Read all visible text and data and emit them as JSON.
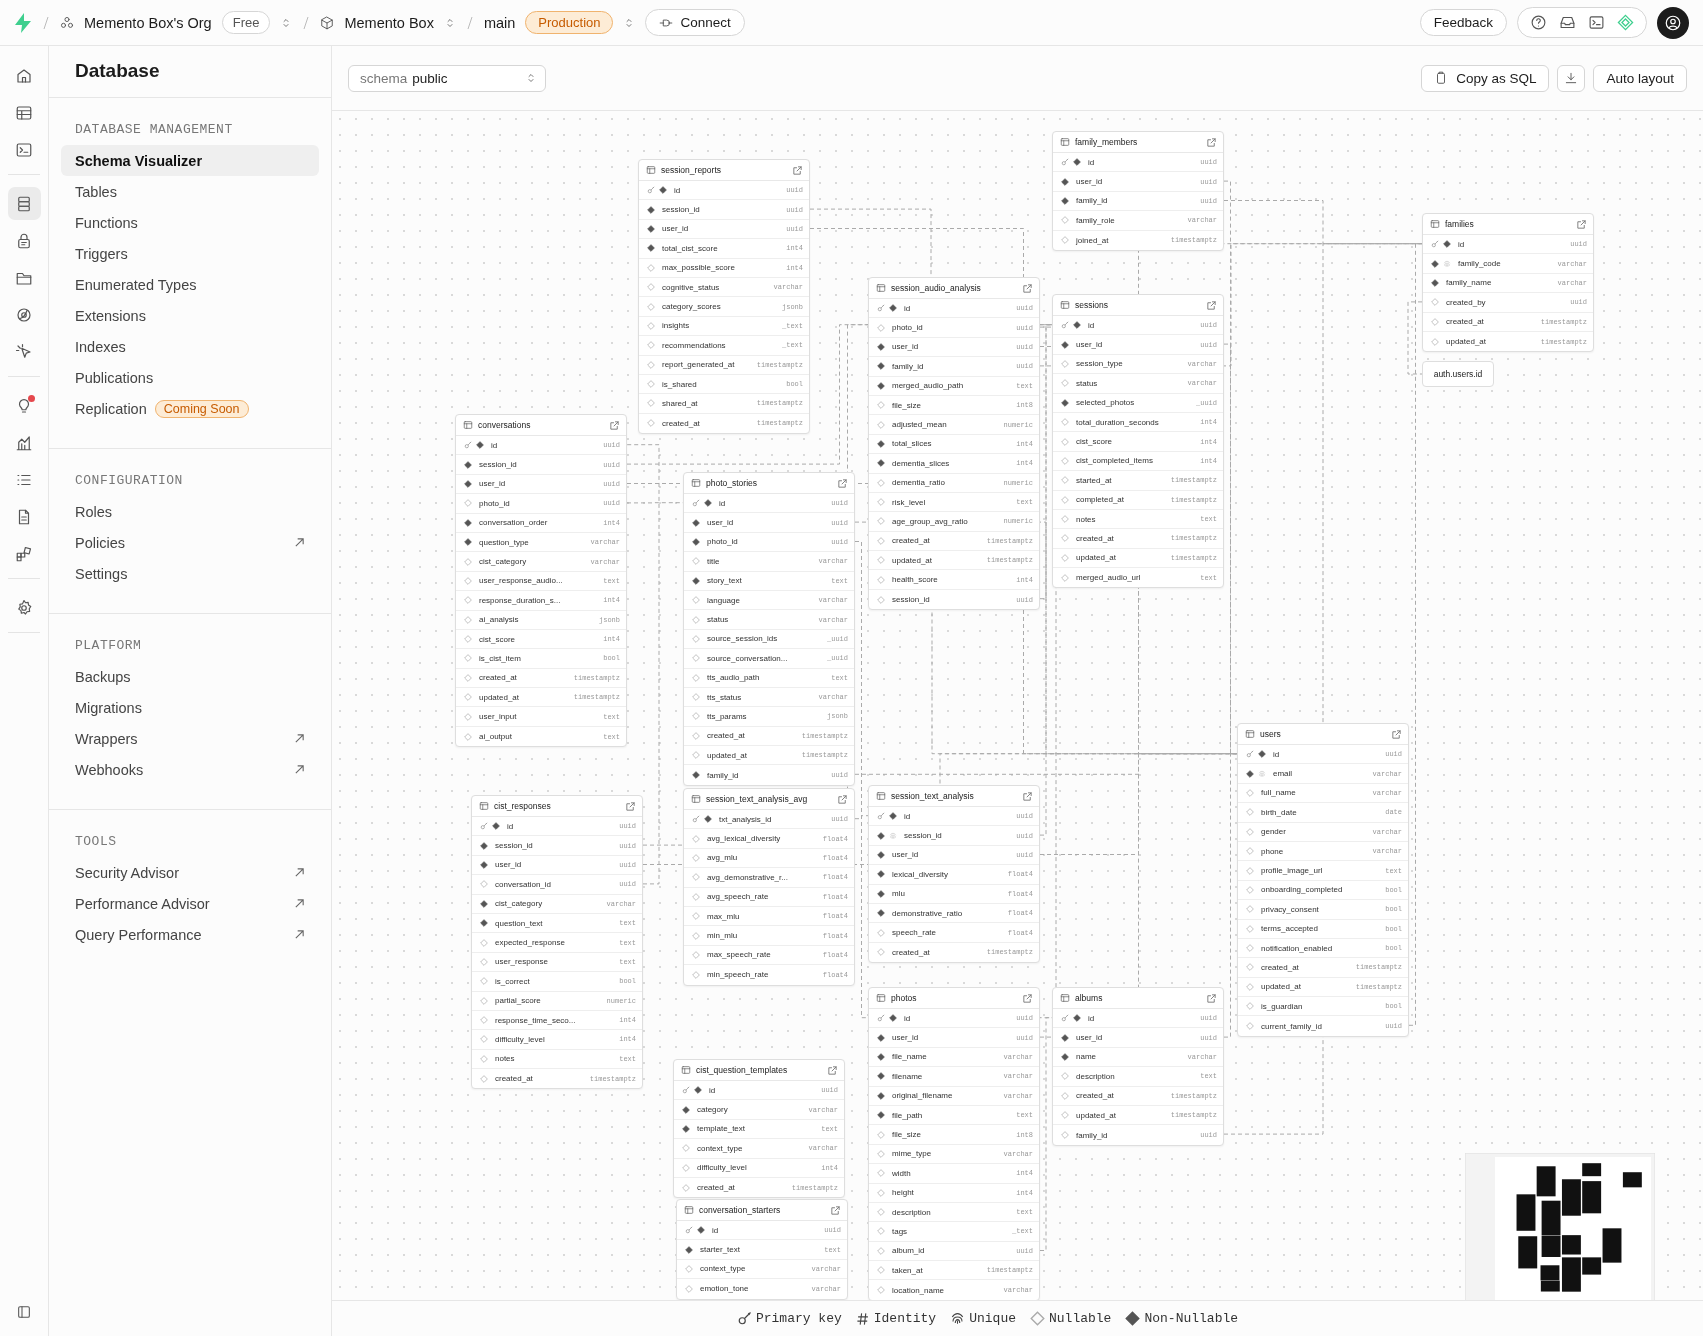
{
  "topbar": {
    "org": "Memento Box's Org",
    "plan": "Free",
    "project": "Memento Box",
    "branch": "main",
    "environment": "Production",
    "connect": "Connect",
    "feedback": "Feedback"
  },
  "rail_groups": [
    {
      "items": [
        {
          "kind": "home",
          "selected": false,
          "alert": false
        },
        {
          "kind": "table",
          "selected": false,
          "alert": false
        },
        {
          "kind": "terminal",
          "selected": false,
          "alert": false
        }
      ]
    },
    {
      "items": [
        {
          "kind": "database",
          "selected": true,
          "alert": false
        },
        {
          "kind": "lock",
          "selected": false,
          "alert": false
        },
        {
          "kind": "folder",
          "selected": false,
          "alert": false
        },
        {
          "kind": "realtime",
          "selected": false,
          "alert": false
        },
        {
          "kind": "cursor",
          "selected": false,
          "alert": false
        }
      ]
    },
    {
      "items": [
        {
          "kind": "bulb",
          "selected": false,
          "alert": true
        },
        {
          "kind": "chart",
          "selected": false,
          "alert": false
        },
        {
          "kind": "list",
          "selected": false,
          "alert": false
        },
        {
          "kind": "doc",
          "selected": false,
          "alert": false
        },
        {
          "kind": "blocks",
          "selected": false,
          "alert": false
        }
      ]
    },
    {
      "items": [
        {
          "kind": "gear",
          "selected": false,
          "alert": false
        }
      ]
    }
  ],
  "sidebar": {
    "title": "Database",
    "sections": [
      {
        "heading": "DATABASE MANAGEMENT",
        "items": [
          {
            "label": "Schema Visualizer",
            "selected": true,
            "external": false
          },
          {
            "label": "Tables",
            "selected": false,
            "external": false
          },
          {
            "label": "Functions",
            "selected": false,
            "external": false
          },
          {
            "label": "Triggers",
            "selected": false,
            "external": false
          },
          {
            "label": "Enumerated Types",
            "selected": false,
            "external": false
          },
          {
            "label": "Extensions",
            "selected": false,
            "external": false
          },
          {
            "label": "Indexes",
            "selected": false,
            "external": false
          },
          {
            "label": "Publications",
            "selected": false,
            "external": false
          },
          {
            "label": "Replication",
            "selected": false,
            "external": false,
            "badge": "Coming Soon"
          }
        ]
      },
      {
        "heading": "CONFIGURATION",
        "items": [
          {
            "label": "Roles",
            "selected": false,
            "external": false
          },
          {
            "label": "Policies",
            "selected": false,
            "external": true
          },
          {
            "label": "Settings",
            "selected": false,
            "external": false
          }
        ]
      },
      {
        "heading": "PLATFORM",
        "items": [
          {
            "label": "Backups",
            "selected": false,
            "external": false
          },
          {
            "label": "Migrations",
            "selected": false,
            "external": false
          },
          {
            "label": "Wrappers",
            "selected": false,
            "external": true
          },
          {
            "label": "Webhooks",
            "selected": false,
            "external": true
          }
        ]
      },
      {
        "heading": "TOOLS",
        "items": [
          {
            "label": "Security Advisor",
            "selected": false,
            "external": true
          },
          {
            "label": "Performance Advisor",
            "selected": false,
            "external": true
          },
          {
            "label": "Query Performance",
            "selected": false,
            "external": true
          }
        ]
      }
    ]
  },
  "toolbar": {
    "schema_label": "schema",
    "schema": "public",
    "buttons": [
      {
        "kind": "copy",
        "label": "Copy as SQL"
      },
      {
        "kind": "download"
      },
      {
        "kind": "plain",
        "label": "Auto layout"
      }
    ]
  },
  "tables": [
    {
      "name": "session_reports",
      "columns": [
        {
          "name": "id",
          "type": "uuid",
          "pk": true,
          "unique": false,
          "nullable": false
        },
        {
          "name": "session_id",
          "type": "uuid",
          "pk": false,
          "unique": false,
          "nullable": false
        },
        {
          "name": "user_id",
          "type": "uuid",
          "pk": false,
          "unique": false,
          "nullable": false
        },
        {
          "name": "total_cist_score",
          "type": "int4",
          "pk": false,
          "unique": false,
          "nullable": false
        },
        {
          "name": "max_possible_score",
          "type": "int4",
          "pk": false,
          "unique": false,
          "nullable": true
        },
        {
          "name": "cognitive_status",
          "type": "varchar",
          "pk": false,
          "unique": false,
          "nullable": true
        },
        {
          "name": "category_scores",
          "type": "jsonb",
          "pk": false,
          "unique": false,
          "nullable": true
        },
        {
          "name": "insights",
          "type": "_text",
          "pk": false,
          "unique": false,
          "nullable": true
        },
        {
          "name": "recommendations",
          "type": "_text",
          "pk": false,
          "unique": false,
          "nullable": true
        },
        {
          "name": "report_generated_at",
          "type": "timestamptz",
          "pk": false,
          "unique": false,
          "nullable": true
        },
        {
          "name": "is_shared",
          "type": "bool",
          "pk": false,
          "unique": false,
          "nullable": true
        },
        {
          "name": "shared_at",
          "type": "timestamptz",
          "pk": false,
          "unique": false,
          "nullable": true
        },
        {
          "name": "created_at",
          "type": "timestamptz",
          "pk": false,
          "unique": false,
          "nullable": true
        }
      ]
    },
    {
      "name": "family_members",
      "columns": [
        {
          "name": "id",
          "type": "uuid",
          "pk": true,
          "unique": false,
          "nullable": false
        },
        {
          "name": "user_id",
          "type": "uuid",
          "pk": false,
          "unique": false,
          "nullable": false
        },
        {
          "name": "family_id",
          "type": "uuid",
          "pk": false,
          "unique": false,
          "nullable": false
        },
        {
          "name": "family_role",
          "type": "varchar",
          "pk": false,
          "unique": false,
          "nullable": true
        },
        {
          "name": "joined_at",
          "type": "timestamptz",
          "pk": false,
          "unique": false,
          "nullable": true
        }
      ]
    },
    {
      "name": "families",
      "columns": [
        {
          "name": "id",
          "type": "uuid",
          "pk": true,
          "unique": false,
          "nullable": false
        },
        {
          "name": "family_code",
          "type": "varchar",
          "pk": false,
          "unique": true,
          "nullable": false
        },
        {
          "name": "family_name",
          "type": "varchar",
          "pk": false,
          "unique": false,
          "nullable": false
        },
        {
          "name": "created_by",
          "type": "uuid",
          "pk": false,
          "unique": false,
          "nullable": true
        },
        {
          "name": "created_at",
          "type": "timestamptz",
          "pk": false,
          "unique": false,
          "nullable": true
        },
        {
          "name": "updated_at",
          "type": "timestamptz",
          "pk": false,
          "unique": false,
          "nullable": true
        }
      ]
    },
    {
      "name": "session_audio_analysis",
      "columns": [
        {
          "name": "id",
          "type": "uuid",
          "pk": true,
          "unique": false,
          "nullable": false
        },
        {
          "name": "photo_id",
          "type": "uuid",
          "pk": false,
          "unique": false,
          "nullable": true
        },
        {
          "name": "user_id",
          "type": "uuid",
          "pk": false,
          "unique": false,
          "nullable": false
        },
        {
          "name": "family_id",
          "type": "uuid",
          "pk": false,
          "unique": false,
          "nullable": false
        },
        {
          "name": "merged_audio_path",
          "type": "text",
          "pk": false,
          "unique": false,
          "nullable": false
        },
        {
          "name": "file_size",
          "type": "int8",
          "pk": false,
          "unique": false,
          "nullable": true
        },
        {
          "name": "adjusted_mean",
          "type": "numeric",
          "pk": false,
          "unique": false,
          "nullable": true
        },
        {
          "name": "total_slices",
          "type": "int4",
          "pk": false,
          "unique": false,
          "nullable": false
        },
        {
          "name": "dementia_slices",
          "type": "int4",
          "pk": false,
          "unique": false,
          "nullable": false
        },
        {
          "name": "dementia_ratio",
          "type": "numeric",
          "pk": false,
          "unique": false,
          "nullable": true
        },
        {
          "name": "risk_level",
          "type": "text",
          "pk": false,
          "unique": false,
          "nullable": true
        },
        {
          "name": "age_group_avg_ratio",
          "type": "numeric",
          "pk": false,
          "unique": false,
          "nullable": true
        },
        {
          "name": "created_at",
          "type": "timestamptz",
          "pk": false,
          "unique": false,
          "nullable": true
        },
        {
          "name": "updated_at",
          "type": "timestamptz",
          "pk": false,
          "unique": false,
          "nullable": true
        },
        {
          "name": "health_score",
          "type": "int4",
          "pk": false,
          "unique": false,
          "nullable": true
        },
        {
          "name": "session_id",
          "type": "uuid",
          "pk": false,
          "unique": false,
          "nullable": true
        }
      ]
    },
    {
      "name": "sessions",
      "columns": [
        {
          "name": "id",
          "type": "uuid",
          "pk": true,
          "unique": false,
          "nullable": false
        },
        {
          "name": "user_id",
          "type": "uuid",
          "pk": false,
          "unique": false,
          "nullable": false
        },
        {
          "name": "session_type",
          "type": "varchar",
          "pk": false,
          "unique": false,
          "nullable": true
        },
        {
          "name": "status",
          "type": "varchar",
          "pk": false,
          "unique": false,
          "nullable": true
        },
        {
          "name": "selected_photos",
          "type": "_uuid",
          "pk": false,
          "unique": false,
          "nullable": false
        },
        {
          "name": "total_duration_seconds",
          "type": "int4",
          "pk": false,
          "unique": false,
          "nullable": true
        },
        {
          "name": "cist_score",
          "type": "int4",
          "pk": false,
          "unique": false,
          "nullable": true
        },
        {
          "name": "cist_completed_items",
          "type": "int4",
          "pk": false,
          "unique": false,
          "nullable": true
        },
        {
          "name": "started_at",
          "type": "timestamptz",
          "pk": false,
          "unique": false,
          "nullable": true
        },
        {
          "name": "completed_at",
          "type": "timestamptz",
          "pk": false,
          "unique": false,
          "nullable": true
        },
        {
          "name": "notes",
          "type": "text",
          "pk": false,
          "unique": false,
          "nullable": true
        },
        {
          "name": "created_at",
          "type": "timestamptz",
          "pk": false,
          "unique": false,
          "nullable": true
        },
        {
          "name": "updated_at",
          "type": "timestamptz",
          "pk": false,
          "unique": false,
          "nullable": true
        },
        {
          "name": "merged_audio_url",
          "type": "text",
          "pk": false,
          "unique": false,
          "nullable": true
        }
      ]
    },
    {
      "name": "conversations",
      "columns": [
        {
          "name": "id",
          "type": "uuid",
          "pk": true,
          "unique": false,
          "nullable": false
        },
        {
          "name": "session_id",
          "type": "uuid",
          "pk": false,
          "unique": false,
          "nullable": false
        },
        {
          "name": "user_id",
          "type": "uuid",
          "pk": false,
          "unique": false,
          "nullable": false
        },
        {
          "name": "photo_id",
          "type": "uuid",
          "pk": false,
          "unique": false,
          "nullable": true
        },
        {
          "name": "conversation_order",
          "type": "int4",
          "pk": false,
          "unique": false,
          "nullable": false
        },
        {
          "name": "question_type",
          "type": "varchar",
          "pk": false,
          "unique": false,
          "nullable": false
        },
        {
          "name": "cist_category",
          "type": "varchar",
          "pk": false,
          "unique": false,
          "nullable": true
        },
        {
          "name": "user_response_audio...",
          "type": "text",
          "pk": false,
          "unique": false,
          "nullable": true
        },
        {
          "name": "response_duration_s...",
          "type": "int4",
          "pk": false,
          "unique": false,
          "nullable": true
        },
        {
          "name": "ai_analysis",
          "type": "jsonb",
          "pk": false,
          "unique": false,
          "nullable": true
        },
        {
          "name": "cist_score",
          "type": "int4",
          "pk": false,
          "unique": false,
          "nullable": true
        },
        {
          "name": "is_cist_item",
          "type": "bool",
          "pk": false,
          "unique": false,
          "nullable": true
        },
        {
          "name": "created_at",
          "type": "timestamptz",
          "pk": false,
          "unique": false,
          "nullable": true
        },
        {
          "name": "updated_at",
          "type": "timestamptz",
          "pk": false,
          "unique": false,
          "nullable": true
        },
        {
          "name": "user_input",
          "type": "text",
          "pk": false,
          "unique": false,
          "nullable": true
        },
        {
          "name": "ai_output",
          "type": "text",
          "pk": false,
          "unique": false,
          "nullable": true
        }
      ]
    },
    {
      "name": "photo_stories",
      "columns": [
        {
          "name": "id",
          "type": "uuid",
          "pk": true,
          "unique": false,
          "nullable": false
        },
        {
          "name": "user_id",
          "type": "uuid",
          "pk": false,
          "unique": false,
          "nullable": false
        },
        {
          "name": "photo_id",
          "type": "uuid",
          "pk": false,
          "unique": false,
          "nullable": false
        },
        {
          "name": "title",
          "type": "varchar",
          "pk": false,
          "unique": false,
          "nullable": true
        },
        {
          "name": "story_text",
          "type": "text",
          "pk": false,
          "unique": false,
          "nullable": false
        },
        {
          "name": "language",
          "type": "varchar",
          "pk": false,
          "unique": false,
          "nullable": true
        },
        {
          "name": "status",
          "type": "varchar",
          "pk": false,
          "unique": false,
          "nullable": true
        },
        {
          "name": "source_session_ids",
          "type": "_uuid",
          "pk": false,
          "unique": false,
          "nullable": true
        },
        {
          "name": "source_conversation...",
          "type": "_uuid",
          "pk": false,
          "unique": false,
          "nullable": true
        },
        {
          "name": "tts_audio_path",
          "type": "text",
          "pk": false,
          "unique": false,
          "nullable": true
        },
        {
          "name": "tts_status",
          "type": "varchar",
          "pk": false,
          "unique": false,
          "nullable": true
        },
        {
          "name": "tts_params",
          "type": "jsonb",
          "pk": false,
          "unique": false,
          "nullable": true
        },
        {
          "name": "created_at",
          "type": "timestamptz",
          "pk": false,
          "unique": false,
          "nullable": true
        },
        {
          "name": "updated_at",
          "type": "timestamptz",
          "pk": false,
          "unique": false,
          "nullable": true
        },
        {
          "name": "family_id",
          "type": "uuid",
          "pk": false,
          "unique": false,
          "nullable": false
        }
      ]
    },
    {
      "name": "users",
      "columns": [
        {
          "name": "id",
          "type": "uuid",
          "pk": true,
          "unique": false,
          "nullable": false
        },
        {
          "name": "email",
          "type": "varchar",
          "pk": false,
          "unique": true,
          "nullable": false
        },
        {
          "name": "full_name",
          "type": "varchar",
          "pk": false,
          "unique": false,
          "nullable": true
        },
        {
          "name": "birth_date",
          "type": "date",
          "pk": false,
          "unique": false,
          "nullable": true
        },
        {
          "name": "gender",
          "type": "varchar",
          "pk": false,
          "unique": false,
          "nullable": true
        },
        {
          "name": "phone",
          "type": "varchar",
          "pk": false,
          "unique": false,
          "nullable": true
        },
        {
          "name": "profile_image_url",
          "type": "text",
          "pk": false,
          "unique": false,
          "nullable": true
        },
        {
          "name": "onboarding_completed",
          "type": "bool",
          "pk": false,
          "unique": false,
          "nullable": true
        },
        {
          "name": "privacy_consent",
          "type": "bool",
          "pk": false,
          "unique": false,
          "nullable": true
        },
        {
          "name": "terms_accepted",
          "type": "bool",
          "pk": false,
          "unique": false,
          "nullable": true
        },
        {
          "name": "notification_enabled",
          "type": "bool",
          "pk": false,
          "unique": false,
          "nullable": true
        },
        {
          "name": "created_at",
          "type": "timestamptz",
          "pk": false,
          "unique": false,
          "nullable": true
        },
        {
          "name": "updated_at",
          "type": "timestamptz",
          "pk": false,
          "unique": false,
          "nullable": true
        },
        {
          "name": "is_guardian",
          "type": "bool",
          "pk": false,
          "unique": false,
          "nullable": true
        },
        {
          "name": "current_family_id",
          "type": "uuid",
          "pk": false,
          "unique": false,
          "nullable": true
        }
      ]
    },
    {
      "name": "session_text_analysis_avg",
      "columns": [
        {
          "name": "txt_analysis_id",
          "type": "uuid",
          "pk": true,
          "unique": false,
          "nullable": false
        },
        {
          "name": "avg_lexical_diversity",
          "type": "float4",
          "pk": false,
          "unique": false,
          "nullable": true
        },
        {
          "name": "avg_mlu",
          "type": "float4",
          "pk": false,
          "unique": false,
          "nullable": true
        },
        {
          "name": "avg_demonstrative_r...",
          "type": "float4",
          "pk": false,
          "unique": false,
          "nullable": true
        },
        {
          "name": "avg_speech_rate",
          "type": "float4",
          "pk": false,
          "unique": false,
          "nullable": true
        },
        {
          "name": "max_mlu",
          "type": "float4",
          "pk": false,
          "unique": false,
          "nullable": true
        },
        {
          "name": "min_mlu",
          "type": "float4",
          "pk": false,
          "unique": false,
          "nullable": true
        },
        {
          "name": "max_speech_rate",
          "type": "float4",
          "pk": false,
          "unique": false,
          "nullable": true
        },
        {
          "name": "min_speech_rate",
          "type": "float4",
          "pk": false,
          "unique": false,
          "nullable": true
        }
      ]
    },
    {
      "name": "session_text_analysis",
      "columns": [
        {
          "name": "id",
          "type": "uuid",
          "pk": true,
          "unique": false,
          "nullable": false
        },
        {
          "name": "session_id",
          "type": "uuid",
          "pk": false,
          "unique": true,
          "nullable": false
        },
        {
          "name": "user_id",
          "type": "uuid",
          "pk": false,
          "unique": false,
          "nullable": false
        },
        {
          "name": "lexical_diversity",
          "type": "float4",
          "pk": false,
          "unique": false,
          "nullable": false
        },
        {
          "name": "mlu",
          "type": "float4",
          "pk": false,
          "unique": false,
          "nullable": false
        },
        {
          "name": "demonstrative_ratio",
          "type": "float4",
          "pk": false,
          "unique": false,
          "nullable": false
        },
        {
          "name": "speech_rate",
          "type": "float4",
          "pk": false,
          "unique": false,
          "nullable": true
        },
        {
          "name": "created_at",
          "type": "timestamptz",
          "pk": false,
          "unique": false,
          "nullable": true
        }
      ]
    },
    {
      "name": "cist_responses",
      "columns": [
        {
          "name": "id",
          "type": "uuid",
          "pk": true,
          "unique": false,
          "nullable": false
        },
        {
          "name": "session_id",
          "type": "uuid",
          "pk": false,
          "unique": false,
          "nullable": false
        },
        {
          "name": "user_id",
          "type": "uuid",
          "pk": false,
          "unique": false,
          "nullable": false
        },
        {
          "name": "conversation_id",
          "type": "uuid",
          "pk": false,
          "unique": false,
          "nullable": true
        },
        {
          "name": "cist_category",
          "type": "varchar",
          "pk": false,
          "unique": false,
          "nullable": false
        },
        {
          "name": "question_text",
          "type": "text",
          "pk": false,
          "unique": false,
          "nullable": false
        },
        {
          "name": "expected_response",
          "type": "text",
          "pk": false,
          "unique": false,
          "nullable": true
        },
        {
          "name": "user_response",
          "type": "text",
          "pk": false,
          "unique": false,
          "nullable": true
        },
        {
          "name": "is_correct",
          "type": "bool",
          "pk": false,
          "unique": false,
          "nullable": true
        },
        {
          "name": "partial_score",
          "type": "numeric",
          "pk": false,
          "unique": false,
          "nullable": true
        },
        {
          "name": "response_time_seco...",
          "type": "int4",
          "pk": false,
          "unique": false,
          "nullable": true
        },
        {
          "name": "difficulty_level",
          "type": "int4",
          "pk": false,
          "unique": false,
          "nullable": true
        },
        {
          "name": "notes",
          "type": "text",
          "pk": false,
          "unique": false,
          "nullable": true
        },
        {
          "name": "created_at",
          "type": "timestamptz",
          "pk": false,
          "unique": false,
          "nullable": true
        }
      ]
    },
    {
      "name": "photos",
      "columns": [
        {
          "name": "id",
          "type": "uuid",
          "pk": true,
          "unique": false,
          "nullable": false
        },
        {
          "name": "user_id",
          "type": "uuid",
          "pk": false,
          "unique": false,
          "nullable": false
        },
        {
          "name": "file_name",
          "type": "varchar",
          "pk": false,
          "unique": false,
          "nullable": false
        },
        {
          "name": "filename",
          "type": "varchar",
          "pk": false,
          "unique": false,
          "nullable": false
        },
        {
          "name": "original_filename",
          "type": "varchar",
          "pk": false,
          "unique": false,
          "nullable": false
        },
        {
          "name": "file_path",
          "type": "text",
          "pk": false,
          "unique": false,
          "nullable": false
        },
        {
          "name": "file_size",
          "type": "int8",
          "pk": false,
          "unique": false,
          "nullable": true
        },
        {
          "name": "mime_type",
          "type": "varchar",
          "pk": false,
          "unique": false,
          "nullable": true
        },
        {
          "name": "width",
          "type": "int4",
          "pk": false,
          "unique": false,
          "nullable": true
        },
        {
          "name": "height",
          "type": "int4",
          "pk": false,
          "unique": false,
          "nullable": true
        },
        {
          "name": "description",
          "type": "text",
          "pk": false,
          "unique": false,
          "nullable": true
        },
        {
          "name": "tags",
          "type": "_text",
          "pk": false,
          "unique": false,
          "nullable": true
        },
        {
          "name": "album_id",
          "type": "uuid",
          "pk": false,
          "unique": false,
          "nullable": true
        },
        {
          "name": "taken_at",
          "type": "timestamptz",
          "pk": false,
          "unique": false,
          "nullable": true
        },
        {
          "name": "location_name",
          "type": "varchar",
          "pk": false,
          "unique": false,
          "nullable": true
        }
      ]
    },
    {
      "name": "albums",
      "columns": [
        {
          "name": "id",
          "type": "uuid",
          "pk": true,
          "unique": false,
          "nullable": false
        },
        {
          "name": "user_id",
          "type": "uuid",
          "pk": false,
          "unique": false,
          "nullable": false
        },
        {
          "name": "name",
          "type": "varchar",
          "pk": false,
          "unique": false,
          "nullable": false
        },
        {
          "name": "description",
          "type": "text",
          "pk": false,
          "unique": false,
          "nullable": true
        },
        {
          "name": "created_at",
          "type": "timestamptz",
          "pk": false,
          "unique": false,
          "nullable": true
        },
        {
          "name": "updated_at",
          "type": "timestamptz",
          "pk": false,
          "unique": false,
          "nullable": true
        },
        {
          "name": "family_id",
          "type": "uuid",
          "pk": false,
          "unique": false,
          "nullable": true
        }
      ]
    },
    {
      "name": "cist_question_templates",
      "columns": [
        {
          "name": "id",
          "type": "uuid",
          "pk": true,
          "unique": false,
          "nullable": false
        },
        {
          "name": "category",
          "type": "varchar",
          "pk": false,
          "unique": false,
          "nullable": false
        },
        {
          "name": "template_text",
          "type": "text",
          "pk": false,
          "unique": false,
          "nullable": false
        },
        {
          "name": "context_type",
          "type": "varchar",
          "pk": false,
          "unique": false,
          "nullable": true
        },
        {
          "name": "difficulty_level",
          "type": "int4",
          "pk": false,
          "unique": false,
          "nullable": true
        },
        {
          "name": "created_at",
          "type": "timestamptz",
          "pk": false,
          "unique": false,
          "nullable": true
        }
      ]
    },
    {
      "name": "conversation_starters",
      "columns": [
        {
          "name": "id",
          "type": "uuid",
          "pk": true,
          "unique": false,
          "nullable": false
        },
        {
          "name": "starter_text",
          "type": "text",
          "pk": false,
          "unique": false,
          "nullable": false
        },
        {
          "name": "context_type",
          "type": "varchar",
          "pk": false,
          "unique": false,
          "nullable": true
        },
        {
          "name": "emotion_tone",
          "type": "varchar",
          "pk": false,
          "unique": false,
          "nullable": true
        }
      ]
    }
  ],
  "external_reference": {
    "name": "auth.users.id"
  },
  "legend": [
    {
      "kind": "primary",
      "label": "Primary key"
    },
    {
      "kind": "identity",
      "label": "Identity"
    },
    {
      "kind": "unique",
      "label": "Unique"
    },
    {
      "kind": "nullable",
      "label": "Nullable"
    },
    {
      "kind": "non_nullable",
      "label": "Non-Nullable"
    }
  ]
}
